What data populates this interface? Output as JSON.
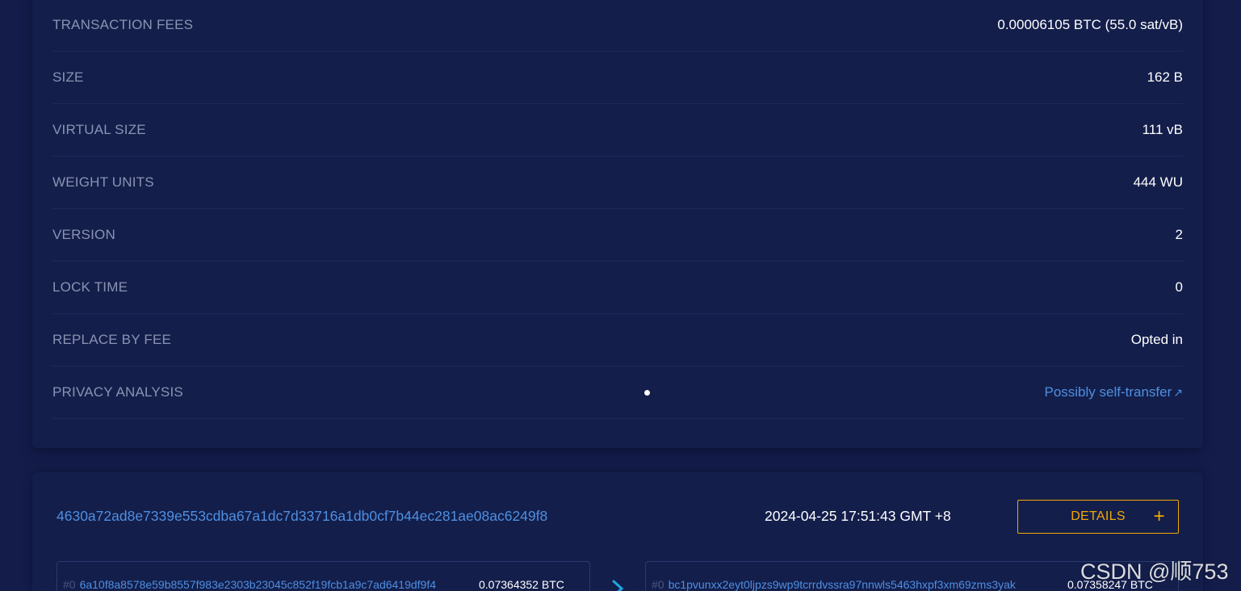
{
  "details": {
    "rows": [
      {
        "label": "TRANSACTION FEES",
        "value": "0.00006105 BTC (55.0 sat/vB)"
      },
      {
        "label": "SIZE",
        "value": "162 B"
      },
      {
        "label": "VIRTUAL SIZE",
        "value": "111 vB"
      },
      {
        "label": "WEIGHT UNITS",
        "value": "444 WU"
      },
      {
        "label": "VERSION",
        "value": "2"
      },
      {
        "label": "LOCK TIME",
        "value": "0"
      },
      {
        "label": "REPLACE BY FEE",
        "value": "Opted in"
      },
      {
        "label": "PRIVACY ANALYSIS",
        "value": "Possibly self-transfer"
      }
    ],
    "external_icon": "↗"
  },
  "transaction": {
    "hash": "4630a72ad8e7339e553cdba67a1dc7d33716a1db0cf7b44ec281ae08ac6249f8",
    "time": "2024-04-25 17:51:43 GMT +8",
    "details_button": "DETAILS",
    "details_plus": "+",
    "input": {
      "index": "#0",
      "address": "6a10f8a8578e59b8557f983e2303b23045c852f19fcb1a9c7ad6419df9f4",
      "amount": "0.07364352 BTC"
    },
    "output": {
      "index": "#0",
      "address": "bc1pvunxx2eyt0ljpzs9wp9tcrrdvssra97nnwls5463hxpf3xm69zms3yak",
      "amount": "0.07358247 BTC"
    }
  },
  "watermark": "CSDN @顺753",
  "colors": {
    "background": "#141d4a",
    "card": "#131e4b",
    "label": "#8a93b2",
    "link": "#4f8fe0",
    "accent": "#f2a900",
    "arrow": "#1fa7e0"
  }
}
